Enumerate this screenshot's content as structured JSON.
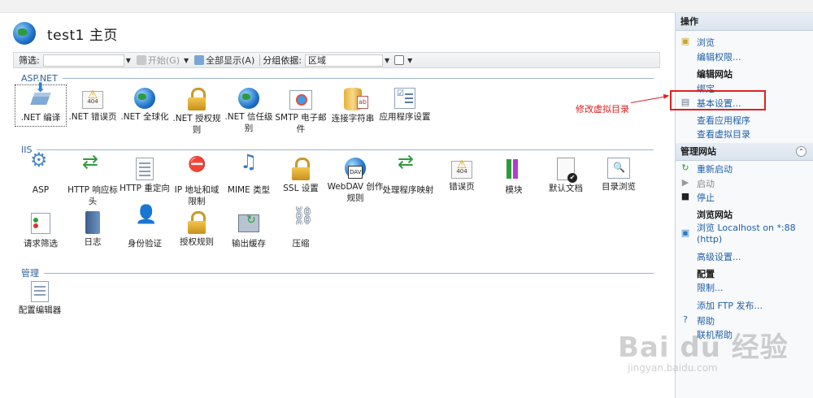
{
  "header": {
    "title": "test1 主页"
  },
  "toolbar": {
    "filter_label": "筛选:",
    "start_label": "开始(G)",
    "show_all_label": "全部显示(A)",
    "group_by_label": "分组依据:",
    "group_by_value": "区域"
  },
  "sections": {
    "aspnet": "ASP.NET",
    "iis": "IIS",
    "management": "管理"
  },
  "aspnet_features": [
    {
      "label": ".NET 编译"
    },
    {
      "label": ".NET 错误页"
    },
    {
      "label": ".NET 全球化"
    },
    {
      "label": ".NET 授权规则"
    },
    {
      "label": ".NET 信任级别"
    },
    {
      "label": "SMTP 电子邮件"
    },
    {
      "label": "连接字符串"
    },
    {
      "label": "应用程序设置"
    }
  ],
  "iis_features": [
    {
      "label": "ASP"
    },
    {
      "label": "HTTP 响应标头"
    },
    {
      "label": "HTTP 重定向"
    },
    {
      "label": "IP 地址和域限制"
    },
    {
      "label": "MIME 类型"
    },
    {
      "label": "SSL 设置"
    },
    {
      "label": "WebDAV 创作规则"
    },
    {
      "label": "处理程序映射"
    },
    {
      "label": "错误页"
    },
    {
      "label": "模块"
    },
    {
      "label": "默认文档"
    },
    {
      "label": "目录浏览"
    },
    {
      "label": "请求筛选"
    },
    {
      "label": "日志"
    },
    {
      "label": "身份验证"
    },
    {
      "label": "授权规则"
    },
    {
      "label": "输出缓存"
    },
    {
      "label": "压缩"
    }
  ],
  "management_features": [
    {
      "label": "配置编辑器"
    }
  ],
  "annotation": {
    "text": "修改虚拟目录",
    "color": "#e02020"
  },
  "actions": {
    "title": "操作",
    "browse": "浏览",
    "edit_permissions": "编辑权限...",
    "edit_site": "编辑网站",
    "bindings": "绑定...",
    "basic_settings": "基本设置...",
    "view_apps": "查看应用程序",
    "view_vdirs": "查看虚拟目录",
    "manage_site": "管理网站",
    "restart": "重新启动",
    "start": "启动",
    "stop": "停止",
    "browse_site": "浏览网站",
    "browse_localhost": "浏览 Localhost on *:88",
    "browse_http": "(http)",
    "advanced_settings": "高级设置...",
    "config": "配置",
    "limits": "限制...",
    "add_ftp": "添加 FTP 发布...",
    "help": "帮助",
    "online_help": "联机帮助"
  },
  "watermark": {
    "brand": "Bai du 经验",
    "url": "jingyan.baidu.com"
  }
}
